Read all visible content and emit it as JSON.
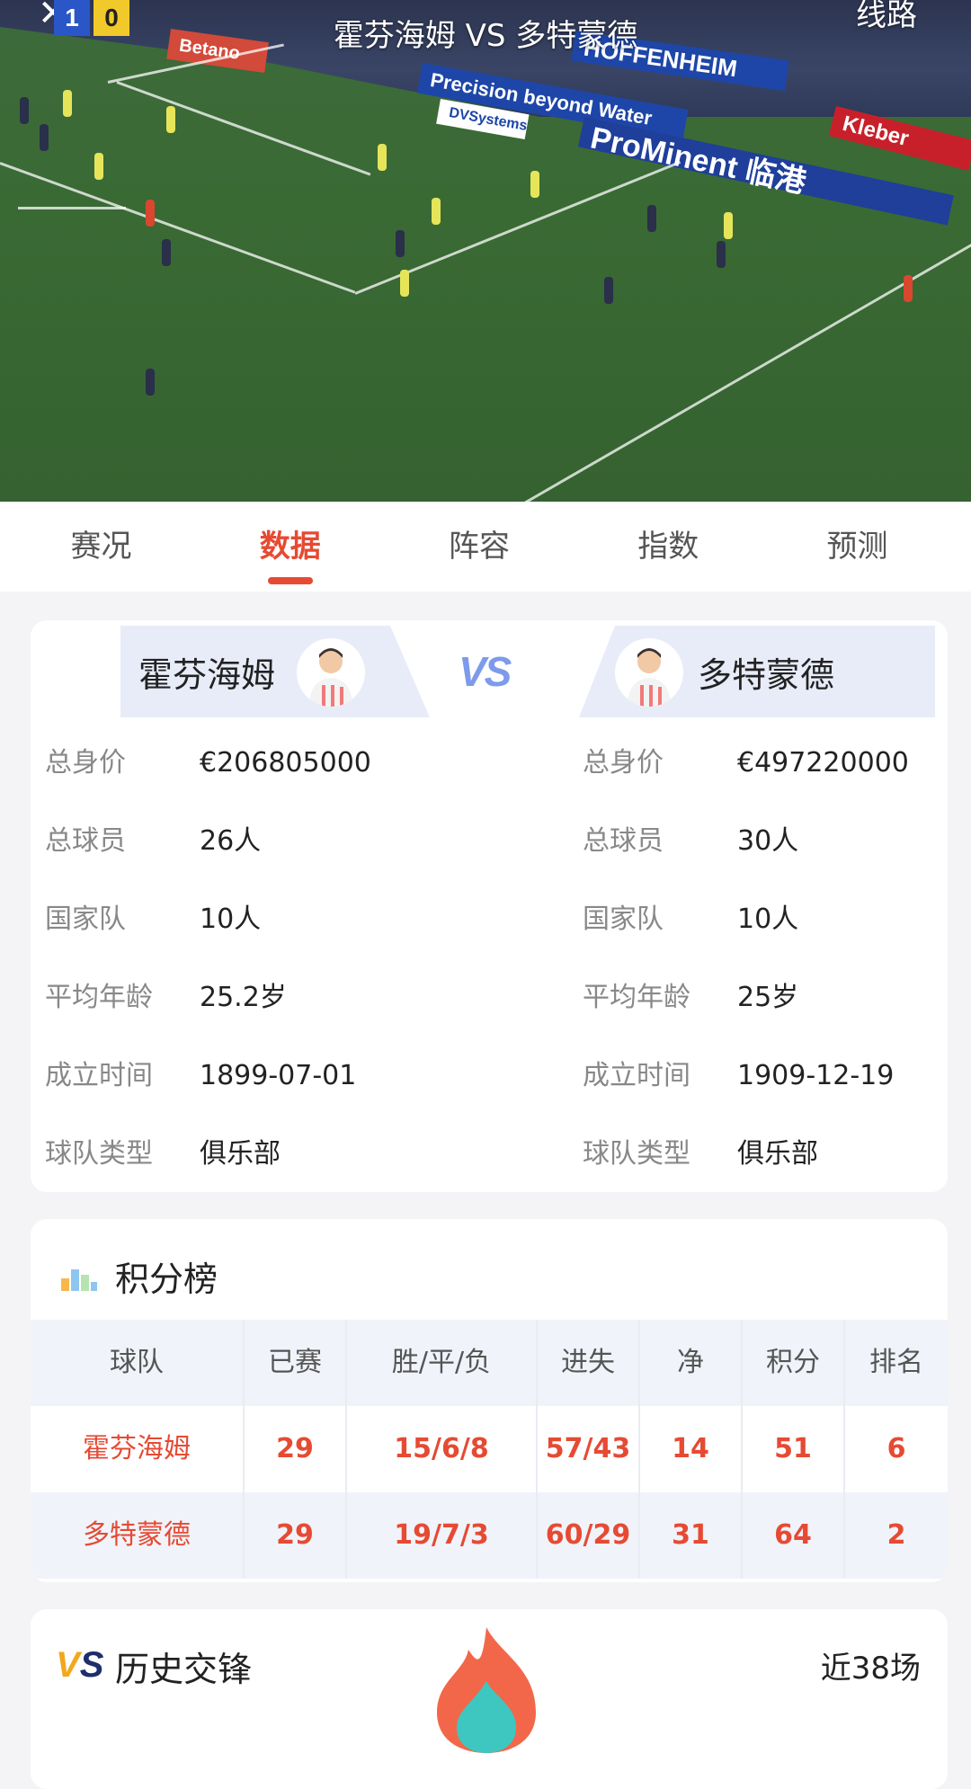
{
  "video": {
    "match_title": "霍芬海姆 VS 多特蒙德",
    "score_home": "1",
    "score_away": "0",
    "route_label": "线路",
    "ads": [
      "Precision beyond Water",
      "ProMinent 临港",
      "Kleber",
      "HOFFENHEIM",
      "Betano",
      "DVSystems"
    ]
  },
  "tabs": [
    {
      "label": "赛况"
    },
    {
      "label": "数据"
    },
    {
      "label": "阵容"
    },
    {
      "label": "指数"
    },
    {
      "label": "预测"
    }
  ],
  "active_tab": "数据",
  "teams": {
    "vs_label": "VS",
    "home": {
      "name": "霍芬海姆",
      "stats": [
        {
          "label": "总身价",
          "value": "€206805000"
        },
        {
          "label": "总球员",
          "value": "26人"
        },
        {
          "label": "国家队",
          "value": "10人"
        },
        {
          "label": "平均年龄",
          "value": "25.2岁"
        },
        {
          "label": "成立时间",
          "value": "1899-07-01"
        },
        {
          "label": "球队类型",
          "value": "俱乐部"
        }
      ]
    },
    "away": {
      "name": "多特蒙德",
      "stats": [
        {
          "label": "总身价",
          "value": "€497220000"
        },
        {
          "label": "总球员",
          "value": "30人"
        },
        {
          "label": "国家队",
          "value": "10人"
        },
        {
          "label": "平均年龄",
          "value": "25岁"
        },
        {
          "label": "成立时间",
          "value": "1909-12-19"
        },
        {
          "label": "球队类型",
          "value": "俱乐部"
        }
      ]
    }
  },
  "standings": {
    "title": "积分榜",
    "columns": [
      "球队",
      "已赛",
      "胜/平/负",
      "进失",
      "净",
      "积分",
      "排名"
    ],
    "rows": [
      [
        "霍芬海姆",
        "29",
        "15/6/8",
        "57/43",
        "14",
        "51",
        "6"
      ],
      [
        "多特蒙德",
        "29",
        "19/7/3",
        "60/29",
        "31",
        "64",
        "2"
      ]
    ]
  },
  "history": {
    "title": "历史交锋",
    "count": "近38场"
  },
  "colors": {
    "accent": "#e64a33",
    "vs_blue": "#7d9bea",
    "pitch": "#3a6a34"
  }
}
